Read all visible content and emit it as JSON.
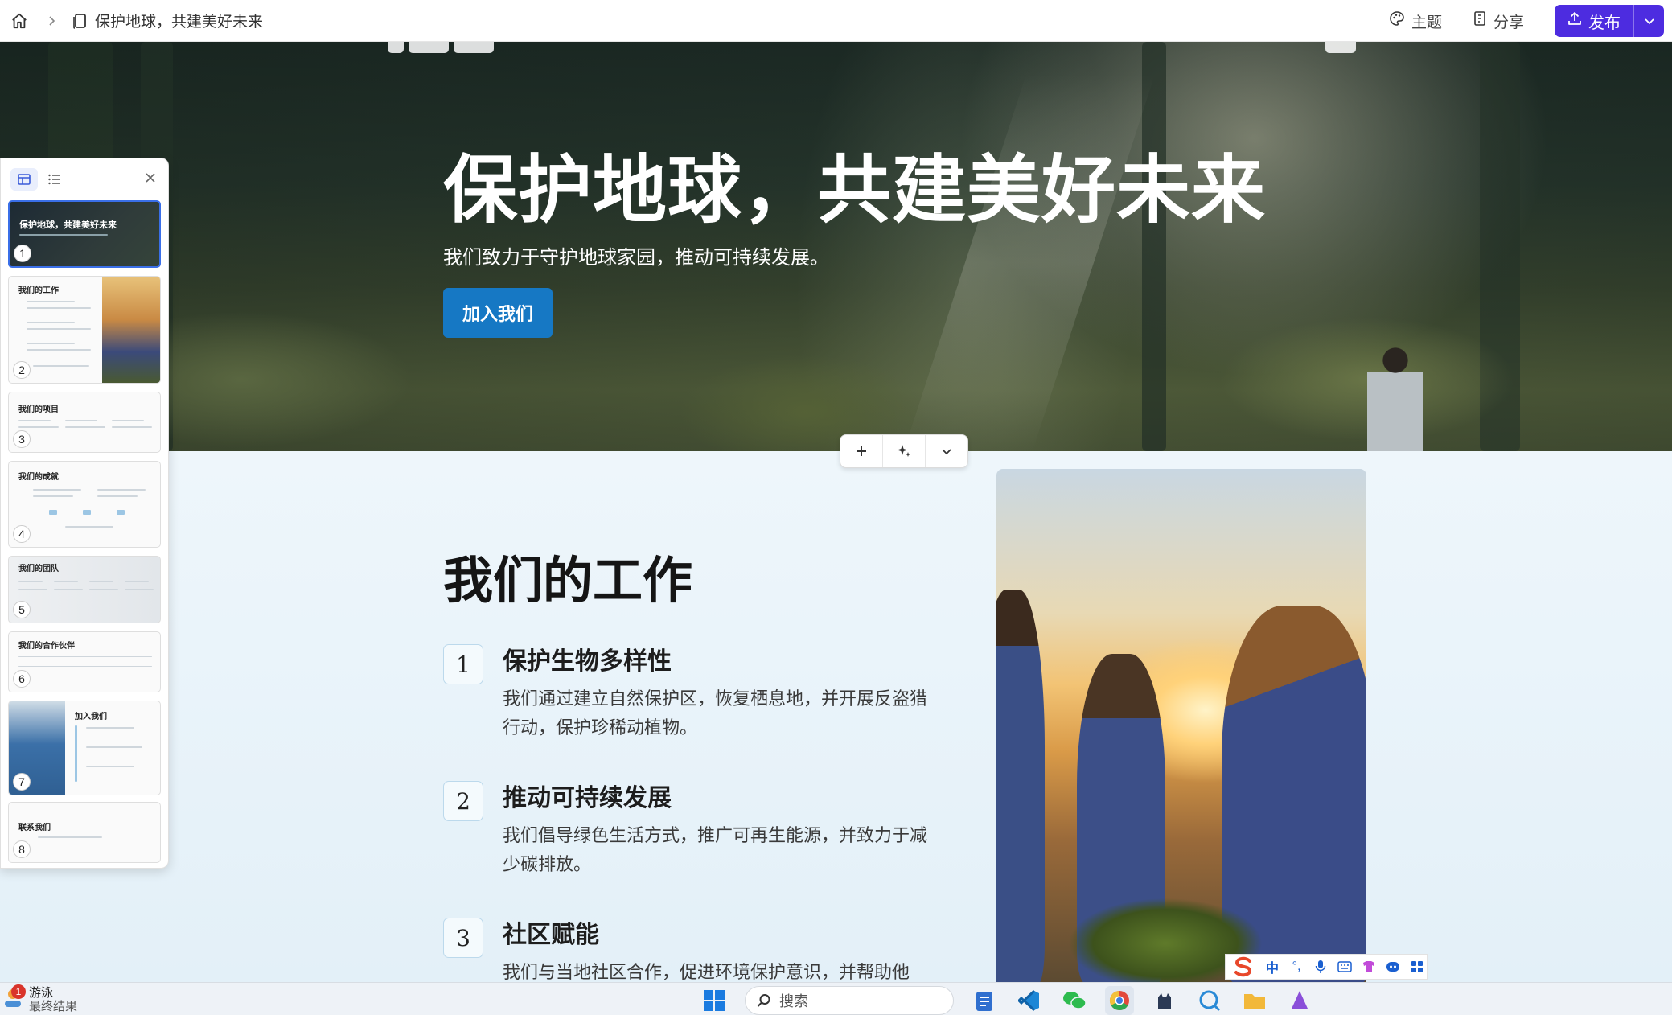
{
  "app": {
    "doc_title": "保护地球，共建美好未来"
  },
  "topbar": {
    "theme_label": "主题",
    "share_label": "分享",
    "publish_label": "发布"
  },
  "hero": {
    "title": "保护地球，共建美好未来",
    "subtitle": "我们致力于守护地球家园，推动可持续发展。",
    "cta_label": "加入我们"
  },
  "work": {
    "title": "我们的工作",
    "items": [
      {
        "num": "1",
        "title": "保护生物多样性",
        "body": "我们通过建立自然保护区，恢复栖息地，并开展反盗猎行动，保护珍稀动植物。"
      },
      {
        "num": "2",
        "title": "推动可持续发展",
        "body": "我们倡导绿色生活方式，推广可再生能源，并致力于减少碳排放。"
      },
      {
        "num": "3",
        "title": "社区赋能",
        "body": "我们与当地社区合作，促进环境保护意识，并帮助他"
      }
    ]
  },
  "slides": [
    {
      "num": "1",
      "title": "保护地球，共建美好未来"
    },
    {
      "num": "2",
      "title": "我们的工作"
    },
    {
      "num": "3",
      "title": "我们的项目"
    },
    {
      "num": "4",
      "title": "我们的成就"
    },
    {
      "num": "5",
      "title": "我们的团队"
    },
    {
      "num": "6",
      "title": "我们的合作伙伴"
    },
    {
      "num": "7",
      "title": "加入我们"
    },
    {
      "num": "8",
      "title": "联系我们"
    }
  ],
  "ime": {
    "mode": "中"
  },
  "taskbar": {
    "weather_title": "游泳",
    "weather_sub": "最终结果",
    "badge": "1",
    "search_placeholder": "搜索"
  },
  "colors": {
    "accent": "#4d2ce0",
    "cta": "#1678c4",
    "selected_thumb": "#3a6fe8"
  },
  "icons": [
    "home-icon",
    "chevron-right-icon",
    "document-icon",
    "palette-icon",
    "share-icon",
    "upload-icon",
    "chevron-down-icon",
    "plus-icon",
    "sparkle-icon",
    "grid-view-icon",
    "list-view-icon",
    "close-icon",
    "windows-start-icon",
    "search-icon"
  ]
}
